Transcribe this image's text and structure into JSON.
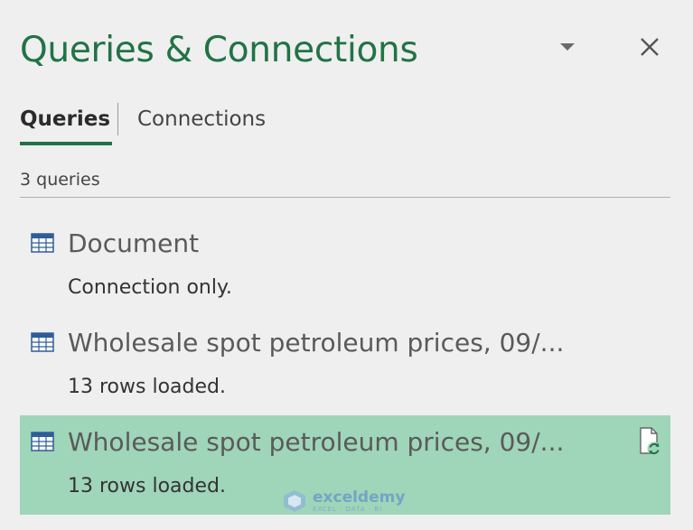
{
  "pane": {
    "title": "Queries & Connections",
    "dropdown_icon": "chevron-down-icon",
    "close_icon": "close-icon"
  },
  "tabs": [
    {
      "label": "Queries",
      "active": true
    },
    {
      "label": "Connections",
      "active": false
    }
  ],
  "query_count": "3 queries",
  "queries": [
    {
      "name": "Document",
      "status": "Connection only.",
      "icon": "table-icon",
      "selected": false
    },
    {
      "name": "Wholesale spot petroleum prices, 09/...",
      "status": "13 rows loaded.",
      "icon": "table-icon",
      "selected": false
    },
    {
      "name": "Wholesale spot petroleum prices, 09/...",
      "status": "13 rows loaded.",
      "icon": "table-icon",
      "selected": true,
      "action_icon": "refresh-icon"
    }
  ],
  "watermark": {
    "name": "exceldemy",
    "tagline": "EXCEL · DATA · BI"
  },
  "colors": {
    "accent": "#217346",
    "selected_row": "#9fd5b8",
    "background": "#efefef",
    "table_icon": "#2e5d9a"
  }
}
